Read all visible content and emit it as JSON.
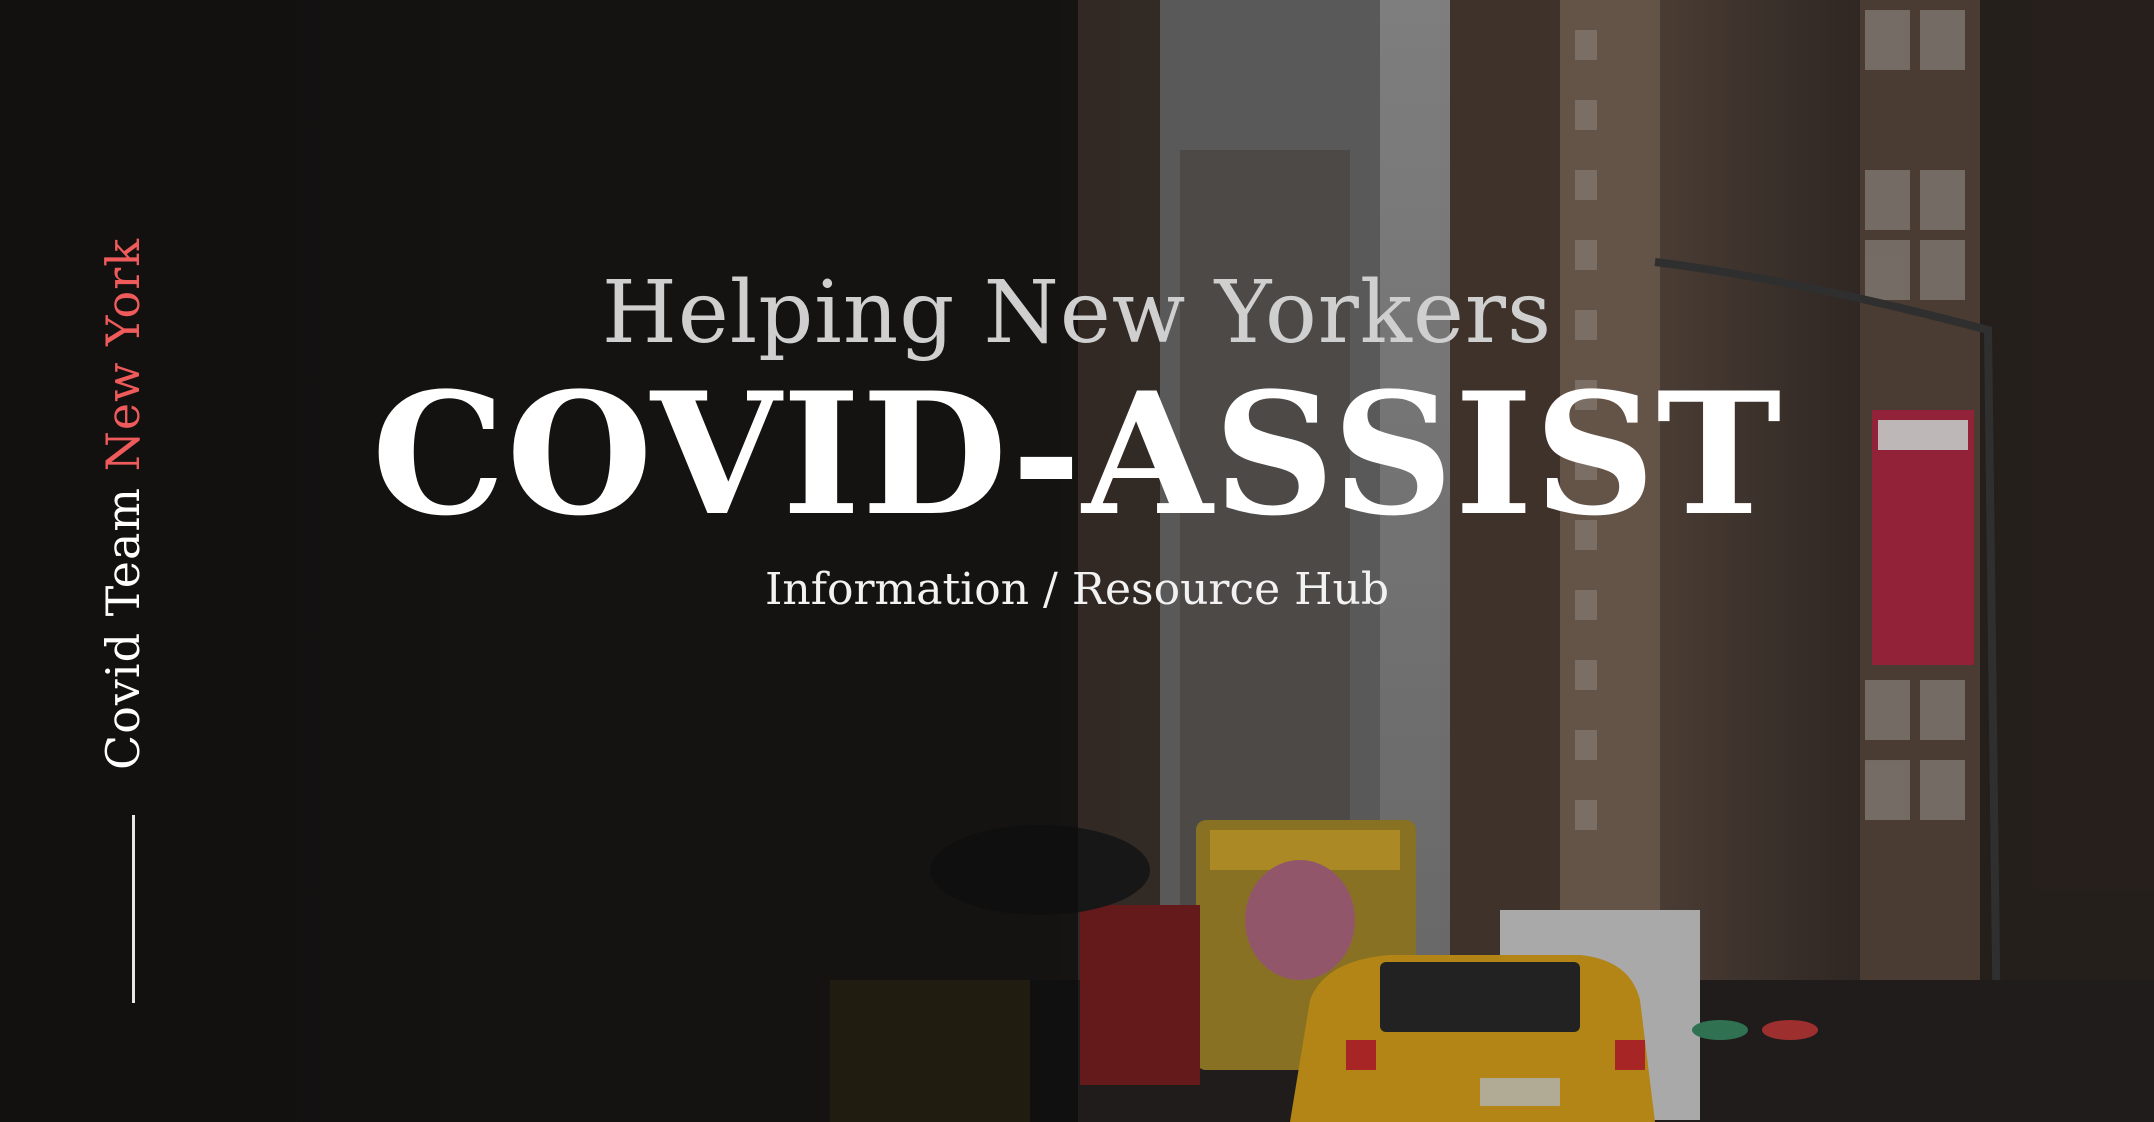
{
  "sidebar": {
    "label_prefix": "Covid Team ",
    "label_accent": "New York"
  },
  "hero": {
    "subtitle": "Helping New Yorkers",
    "title": "COVID-ASSIST",
    "tagline": "Information / Resource Hub"
  },
  "colors": {
    "accent": "#ef5b5b",
    "text": "#ffffff",
    "subtitle": "#cfcfcf"
  }
}
